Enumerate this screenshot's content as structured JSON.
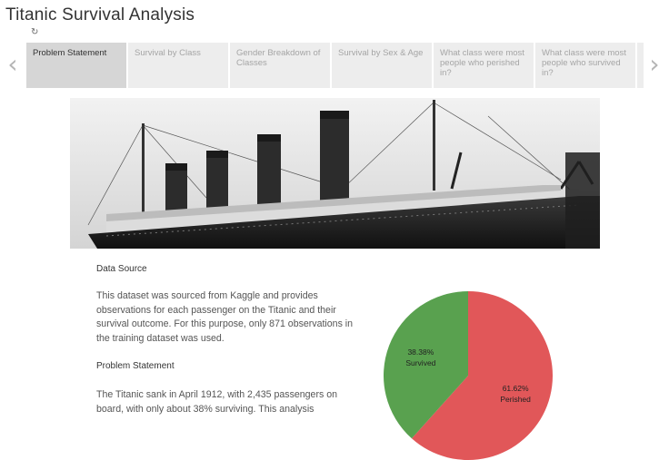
{
  "app": {
    "title": "Titanic Survival Analysis"
  },
  "icons": {
    "reset": "reset-icon",
    "prev": "chevron-left-icon",
    "next": "chevron-right-icon"
  },
  "nav": {
    "prev_glyph": "‹",
    "next_glyph": "›"
  },
  "story_points": [
    {
      "label": "Problem Statement",
      "active": true
    },
    {
      "label": "Survival by Class",
      "active": false
    },
    {
      "label": "Gender Breakdown of Classes",
      "active": false
    },
    {
      "label": "Survival by Sex & Age",
      "active": false
    },
    {
      "label": "What class were most people who perished in?",
      "active": false
    },
    {
      "label": "What class were most people who survived in?",
      "active": false
    }
  ],
  "content": {
    "data_source_heading": "Data Source",
    "data_source_text": "This dataset was sourced from Kaggle and provides observations for each passenger on the Titanic and their survival outcome. For this purpose, only 871 observations in the training dataset was used.",
    "problem_heading": "Problem Statement",
    "problem_text": "The Titanic sank in April 1912, with 2,435 passengers on board, with only about 38% surviving. This analysis"
  },
  "chart_data": {
    "type": "pie",
    "slices": [
      {
        "name": "Survived",
        "value": 38.38,
        "label": "38.38%",
        "color": "#59a14f"
      },
      {
        "name": "Perished",
        "value": 61.62,
        "label": "61.62%",
        "color": "#e15759"
      }
    ]
  }
}
